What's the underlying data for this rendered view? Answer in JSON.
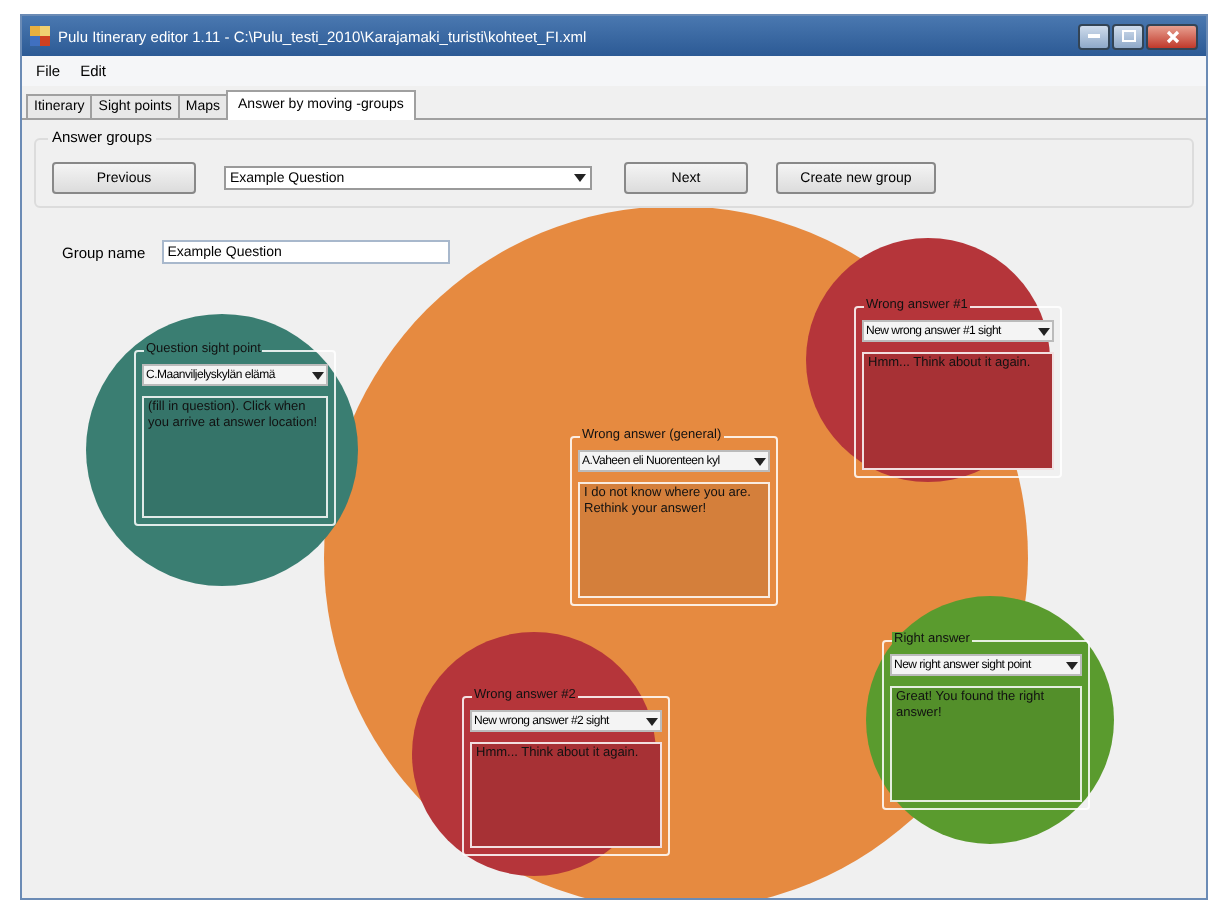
{
  "window": {
    "title": "Pulu Itinerary editor 1.11 - C:\\Pulu_testi_2010\\Karajamaki_turisti\\kohteet_FI.xml"
  },
  "menu": [
    "File",
    "Edit"
  ],
  "tabs": [
    {
      "label": "Itinerary",
      "selected": false
    },
    {
      "label": "Sight points",
      "selected": false
    },
    {
      "label": "Maps",
      "selected": false
    },
    {
      "label": "Answer by moving -groups",
      "selected": true
    }
  ],
  "answer_groups": {
    "title": "Answer groups",
    "previous_button": "Previous",
    "group_select": "Example Question",
    "next_button": "Next",
    "create_button": "Create new group"
  },
  "group_name": {
    "label": "Group name",
    "value": "Example Question"
  },
  "groups": [
    {
      "title": "Wrong answer (general)",
      "sight_point": "A.Vaheen eli Nuorenteen kyl",
      "text": "I do not know where you are. Rethink your answer!",
      "color": "#e68a40"
    },
    {
      "title": "Question sight point",
      "sight_point": "C.Maanviljelyskylän elämä",
      "text": "(fill in question). Click when you arrive at answer location!",
      "color": "#3a7e72"
    },
    {
      "title": "Wrong answer #1",
      "sight_point": "New wrong answer #1 sight",
      "text": "Hmm... Think about it again.",
      "color": "#b5353a"
    },
    {
      "title": "Wrong answer #2",
      "sight_point": "New wrong answer #2 sight",
      "text": "Hmm... Think about it again.",
      "color": "#b5353a"
    },
    {
      "title": "Right answer",
      "sight_point": "New right answer sight point",
      "text": "Great! You found the right answer!",
      "color": "#5a9b2e"
    }
  ]
}
